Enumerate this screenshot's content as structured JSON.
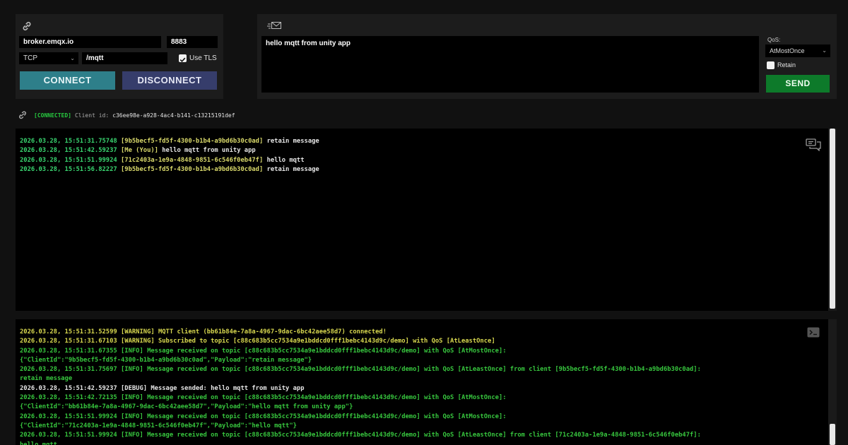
{
  "connection": {
    "host": "broker.emqx.io",
    "port": "8883",
    "protocol": "TCP",
    "path": "/mqtt",
    "use_tls_label": "Use TLS",
    "use_tls_checked": true,
    "connect_label": "CONNECT",
    "disconnect_label": "DISCONNECT"
  },
  "message": {
    "text": "hello mqtt from unity app",
    "qos_label": "QoS:",
    "qos_value": "AtMostOnce",
    "retain_label": "Retain",
    "retain_checked": false,
    "send_label": "SEND"
  },
  "status": {
    "state": "[CONNECTED]",
    "client_label": "Client id:",
    "client_id": "c36ee98e-a928-4ac4-b141-c13215191def"
  },
  "messages": [
    {
      "time": "2026.03.28, 15:51:31.75748",
      "sender": "[9b5becf5-fd5f-4300-b1b4-a9bd6b30c0ad]",
      "text": "retain message"
    },
    {
      "time": "2026.03.28, 15:51:42.59237",
      "sender": "[Me (You)]",
      "text": "hello mqtt from unity app"
    },
    {
      "time": "2026.03.28, 15:51:51.99924",
      "sender": "[71c2403a-1e9a-4848-9851-6c546f0eb47f]",
      "text": "hello mqtt"
    },
    {
      "time": "2026.03.28, 15:51:56.82227",
      "sender": "[9b5becf5-fd5f-4300-b1b4-a9bd6b30c0ad]",
      "text": "retain message"
    }
  ],
  "logs": [
    {
      "level": "warning",
      "text": "2026.03.28, 15:51:31.52599 [WARNING] MQTT client (bb61b84e-7a8a-4967-9dac-6bc42aee58d7) connected!"
    },
    {
      "level": "warning",
      "text": "2026.03.28, 15:51:31.67103 [WARNING] Subscribed to topic [c88c683b5cc7534a9e1bddcd0fff1bebc4143d9c/demo] with QoS [AtLeastOnce]"
    },
    {
      "level": "info",
      "text": "2026.03.28, 15:51:31.67355 [INFO] Message received on topic [c88c683b5cc7534a9e1bddcd0fff1bebc4143d9c/demo] with QoS [AtMostOnce]:"
    },
    {
      "level": "info",
      "text": "{\"ClientId\":\"9b5becf5-fd5f-4300-b1b4-a9bd6b30c0ad\",\"Payload\":\"retain message\"}"
    },
    {
      "level": "info",
      "text": "2026.03.28, 15:51:31.75697 [INFO] Message received on topic [c88c683b5cc7534a9e1bddcd0fff1bebc4143d9c/demo] with QoS [AtLeastOnce] from client [9b5becf5-fd5f-4300-b1b4-a9bd6b30c0ad]:"
    },
    {
      "level": "info",
      "text": "retain message"
    },
    {
      "level": "debug",
      "text": "2026.03.28, 15:51:42.59237 [DEBUG] Message sended: hello mqtt from unity app"
    },
    {
      "level": "info",
      "text": "2026.03.28, 15:51:42.72135 [INFO] Message received on topic [c88c683b5cc7534a9e1bddcd0fff1bebc4143d9c/demo] with QoS [AtMostOnce]:"
    },
    {
      "level": "info",
      "text": "{\"ClientId\":\"bb61b84e-7a8a-4967-9dac-6bc42aee58d7\",\"Payload\":\"hello mqtt from unity app\"}"
    },
    {
      "level": "info",
      "text": "2026.03.28, 15:51:51.99924 [INFO] Message received on topic [c88c683b5cc7534a9e1bddcd0fff1bebc4143d9c/demo] with QoS [AtMostOnce]:"
    },
    {
      "level": "info",
      "text": "{\"ClientId\":\"71c2403a-1e9a-4848-9851-6c546f0eb47f\",\"Payload\":\"hello mqtt\"}"
    },
    {
      "level": "info",
      "text": "2026.03.28, 15:51:51.99924 [INFO] Message received on topic [c88c683b5cc7534a9e1bddcd0fff1bebc4143d9c/demo] with QoS [AtLeastOnce] from client [71c2403a-1e9a-4848-9851-6c546f0eb47f]:"
    },
    {
      "level": "info",
      "text": "hello mqtt"
    }
  ],
  "icons": {
    "link": "link-icon",
    "envelope": "envelope-icon",
    "status_link": "connection-status-icon",
    "chat": "chat-icon",
    "terminal": "terminal-icon"
  },
  "colors": {
    "background": "#111111",
    "panel": "#1c1c1c",
    "connect_button": "#2e7f8a",
    "disconnect_button": "#363d6b",
    "send_button": "#0d7a2a",
    "connected": "#27c93f",
    "timestamp": "#39d46f",
    "sender": "#d8d86a",
    "message_text": "#e6e6e6",
    "log_warning": "#d8d84f",
    "log_info": "#37c63e",
    "log_debug": "#e6e6e6"
  }
}
